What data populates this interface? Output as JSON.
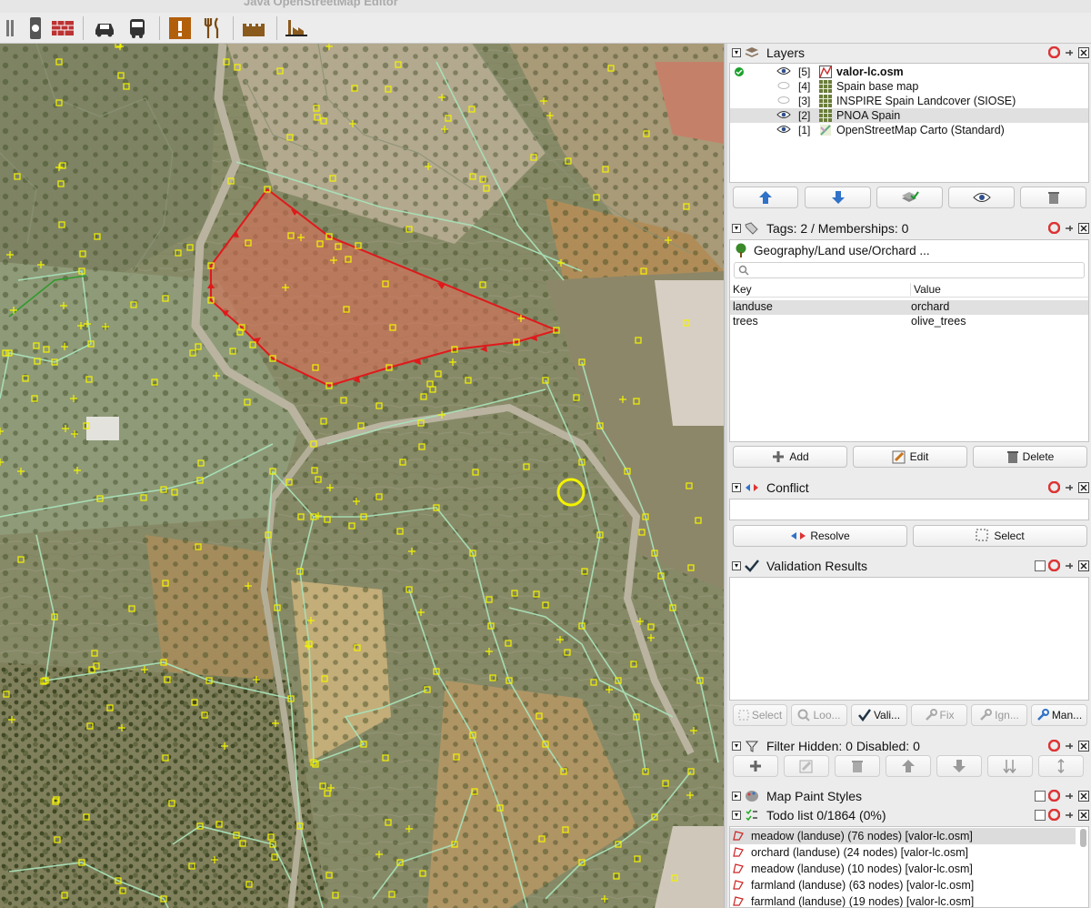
{
  "window": {
    "title": "Java OpenStreetMap Editor"
  },
  "toolbar": {
    "icons": [
      "presets-handle-icon",
      "rail-crossing-icon",
      "wall-icon",
      "car-icon",
      "bus-icon",
      "emergency-icon",
      "restaurant-icon",
      "castle-icon",
      "factory-icon"
    ]
  },
  "layers": {
    "title": "Layers",
    "items": [
      {
        "index": "[5]",
        "name": "valor-lc.osm",
        "visible": true,
        "bold": true,
        "active": true,
        "icon": "osm-data-icon"
      },
      {
        "index": "[4]",
        "name": "Spain base map",
        "visible": false,
        "bold": false,
        "active": false,
        "icon": "imagery-icon"
      },
      {
        "index": "[3]",
        "name": "INSPIRE Spain Landcover (SIOSE)",
        "visible": false,
        "bold": false,
        "active": false,
        "icon": "imagery-icon"
      },
      {
        "index": "[2]",
        "name": "PNOA Spain",
        "visible": true,
        "bold": false,
        "active": false,
        "icon": "imagery-icon"
      },
      {
        "index": "[1]",
        "name": "OpenStreetMap Carto (Standard)",
        "visible": true,
        "bold": false,
        "active": false,
        "icon": "tile-layer-icon"
      }
    ]
  },
  "tags": {
    "title": "Tags: 2 / Memberships: 0",
    "preset": "Geography/Land use/Orchard ...",
    "search_placeholder": "",
    "col_key": "Key",
    "col_value": "Value",
    "rows": [
      {
        "key": "landuse",
        "value": "orchard"
      },
      {
        "key": "trees",
        "value": "olive_trees"
      }
    ],
    "add_label": "Add",
    "edit_label": "Edit",
    "delete_label": "Delete"
  },
  "conflict": {
    "title": "Conflict",
    "resolve_label": "Resolve",
    "select_label": "Select"
  },
  "validation": {
    "title": "Validation Results",
    "buttons": [
      "Select",
      "Loo...",
      "Vali...",
      "Fix",
      "Ign...",
      "Man..."
    ]
  },
  "filter": {
    "title": "Filter Hidden: 0 Disabled: 0"
  },
  "mappaint": {
    "title": "Map Paint Styles"
  },
  "todo": {
    "title": "Todo list 0/1864 (0%)",
    "items": [
      "meadow (landuse) (76 nodes) [valor-lc.osm]",
      "orchard (landuse) (24 nodes) [valor-lc.osm]",
      "meadow (landuse) (10 nodes) [valor-lc.osm]",
      "farmland (landuse) (63 nodes) [valor-lc.osm]",
      "farmland (landuse) (19 nodes) [valor-lc.osm]"
    ]
  },
  "colors": {
    "selected_way": "#e0191b",
    "way": "#a8e0b8",
    "node": "#f2f200",
    "aerial_base": "#8c8f6c"
  }
}
